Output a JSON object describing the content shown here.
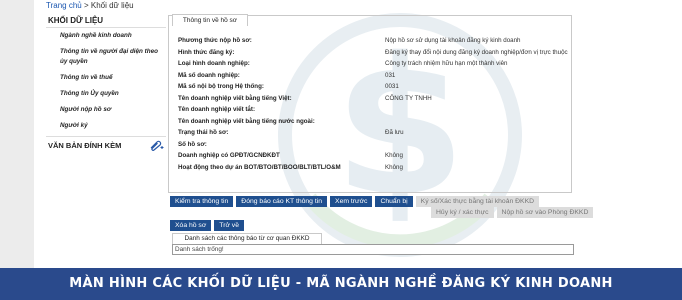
{
  "breadcrumb": {
    "home": "Trang chủ",
    "sep": ">",
    "current": "Khối dữ liệu"
  },
  "sidebar": {
    "title": "KHỐI DỮ LIỆU",
    "items": [
      {
        "label": "Ngành nghề kinh doanh"
      },
      {
        "label": "Thông tin về người đại diện theo ủy quyền"
      },
      {
        "label": "Thông tin về thuế"
      },
      {
        "label": "Thông tin Ủy quyền"
      },
      {
        "label": "Người nộp hồ sơ"
      },
      {
        "label": "Người ký"
      }
    ],
    "attachments_label": "VĂN BẢN ĐÍNH KÈM",
    "attachments_icon": "paperclip-add-icon"
  },
  "panel": {
    "tab_label": "Thông tin về hồ sơ",
    "rows": [
      {
        "key": "Phương thức nộp hồ sơ:",
        "value": "Nộp hồ sơ sử dụng tài khoản đăng ký kinh doanh"
      },
      {
        "key": "Hình thức đăng ký:",
        "value": "Đăng ký thay đổi nội dung đăng ký doanh nghiệp/đơn vị trực thuộc"
      },
      {
        "key": "Loại hình doanh nghiệp:",
        "value": "Công ty trách nhiệm hữu hạn một thành viên"
      },
      {
        "key": "Mã số doanh nghiệp:",
        "value": "031"
      },
      {
        "key": "Mã số nội bộ trong Hệ thống:",
        "value": "0031"
      },
      {
        "key": "Tên doanh nghiệp viết bằng tiếng Việt:",
        "value": "CÔNG TY TNHH"
      },
      {
        "key": "Tên doanh nghiệp viết tắt:",
        "value": ""
      },
      {
        "key": "Tên doanh nghiệp viết bằng tiếng nước ngoài:",
        "value": ""
      },
      {
        "key": "Trạng thái hồ sơ:",
        "value": "Đã lưu"
      },
      {
        "key": "Số hồ sơ:",
        "value": ""
      },
      {
        "key": "Doanh nghiệp có GPĐT/GCNĐKĐT",
        "value": "Không"
      },
      {
        "key": "Hoạt động theo dự án BOT/BTO/BT/BOO/BLT/BTL/O&M",
        "value": "Không"
      }
    ]
  },
  "buttons": {
    "check_info": "Kiểm tra thông tin",
    "report_kt": "Đóng báo cáo KT thông tin",
    "preview": "Xem trước",
    "prepare": "Chuẩn bị",
    "sign_submit": "Ký số/Xác thực bằng tài khoản ĐKKD",
    "cancel_sign": "Hủy ký / xác thực",
    "submit_office": "Nộp hồ sơ vào Phòng ĐKKD",
    "delete": "Xóa hồ sơ",
    "back": "Trở về"
  },
  "notices": {
    "header": "Danh sách các thông báo từ cơ quan ĐKKD",
    "empty": "Danh sách trống!"
  },
  "banner": {
    "text": "MÀN HÌNH CÁC KHỐI DỮ LIỆU - MÃ NGÀNH NGHỀ ĐĂNG KÝ KINH DOANH"
  },
  "colors": {
    "banner_bg": "#2a4a8c",
    "button_bg": "#1f4f8f",
    "link": "#1a56b0"
  }
}
